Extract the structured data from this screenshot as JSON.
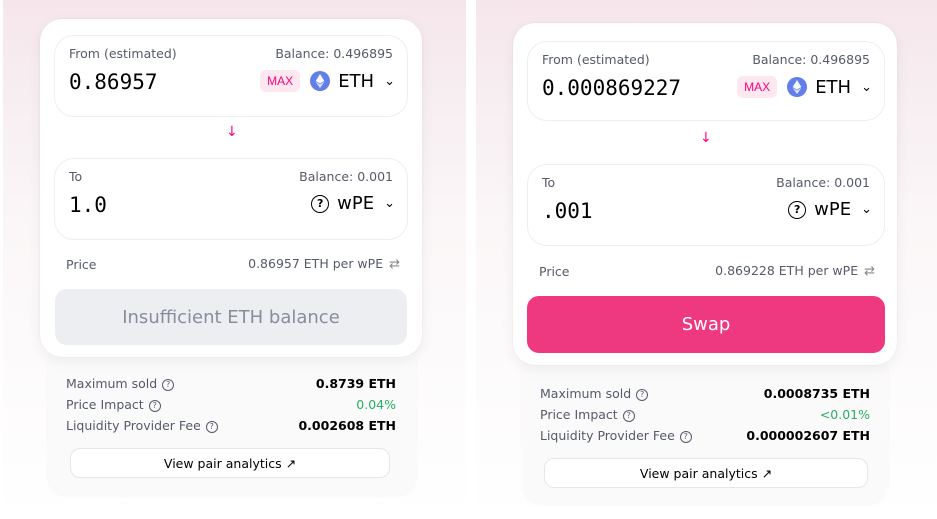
{
  "panels": [
    {
      "from": {
        "label": "From (estimated)",
        "balance": "Balance: 0.496895",
        "amount": "0.86957",
        "max_label": "MAX",
        "token": "ETH",
        "token_icon": "ethereum-icon"
      },
      "to": {
        "label": "To",
        "balance": "Balance: 0.001",
        "amount": "1.0",
        "token": "wPE",
        "token_icon": "unknown-token-icon"
      },
      "price": {
        "label": "Price",
        "value": "0.86957 ETH per wPE"
      },
      "button": {
        "label": "Insufficient ETH balance",
        "state": "disabled"
      },
      "details": {
        "max_sold_label": "Maximum sold",
        "max_sold_value": "0.8739 ETH",
        "impact_label": "Price Impact",
        "impact_value": "0.04%",
        "fee_label": "Liquidity Provider Fee",
        "fee_value": "0.002608 ETH",
        "analytics_label": "View pair analytics ↗"
      }
    },
    {
      "from": {
        "label": "From (estimated)",
        "balance": "Balance: 0.496895",
        "amount": "0.000869227",
        "max_label": "MAX",
        "token": "ETH",
        "token_icon": "ethereum-icon"
      },
      "to": {
        "label": "To",
        "balance": "Balance: 0.001",
        "amount": ".001",
        "token": "wPE",
        "token_icon": "unknown-token-icon"
      },
      "price": {
        "label": "Price",
        "value": "0.869228 ETH per wPE"
      },
      "button": {
        "label": "Swap",
        "state": "enabled"
      },
      "details": {
        "max_sold_label": "Maximum sold",
        "max_sold_value": "0.0008735 ETH",
        "impact_label": "Price Impact",
        "impact_value": "<0.01%",
        "fee_label": "Liquidity Provider Fee",
        "fee_value": "0.000002607 ETH",
        "analytics_label": "View pair analytics ↗"
      }
    }
  ],
  "colors": {
    "accent": "#ff007a",
    "swap_button": "#ee3880",
    "disabled_button": "#edeef2",
    "impact_green": "#27ae60",
    "eth_blue": "#627eea"
  }
}
